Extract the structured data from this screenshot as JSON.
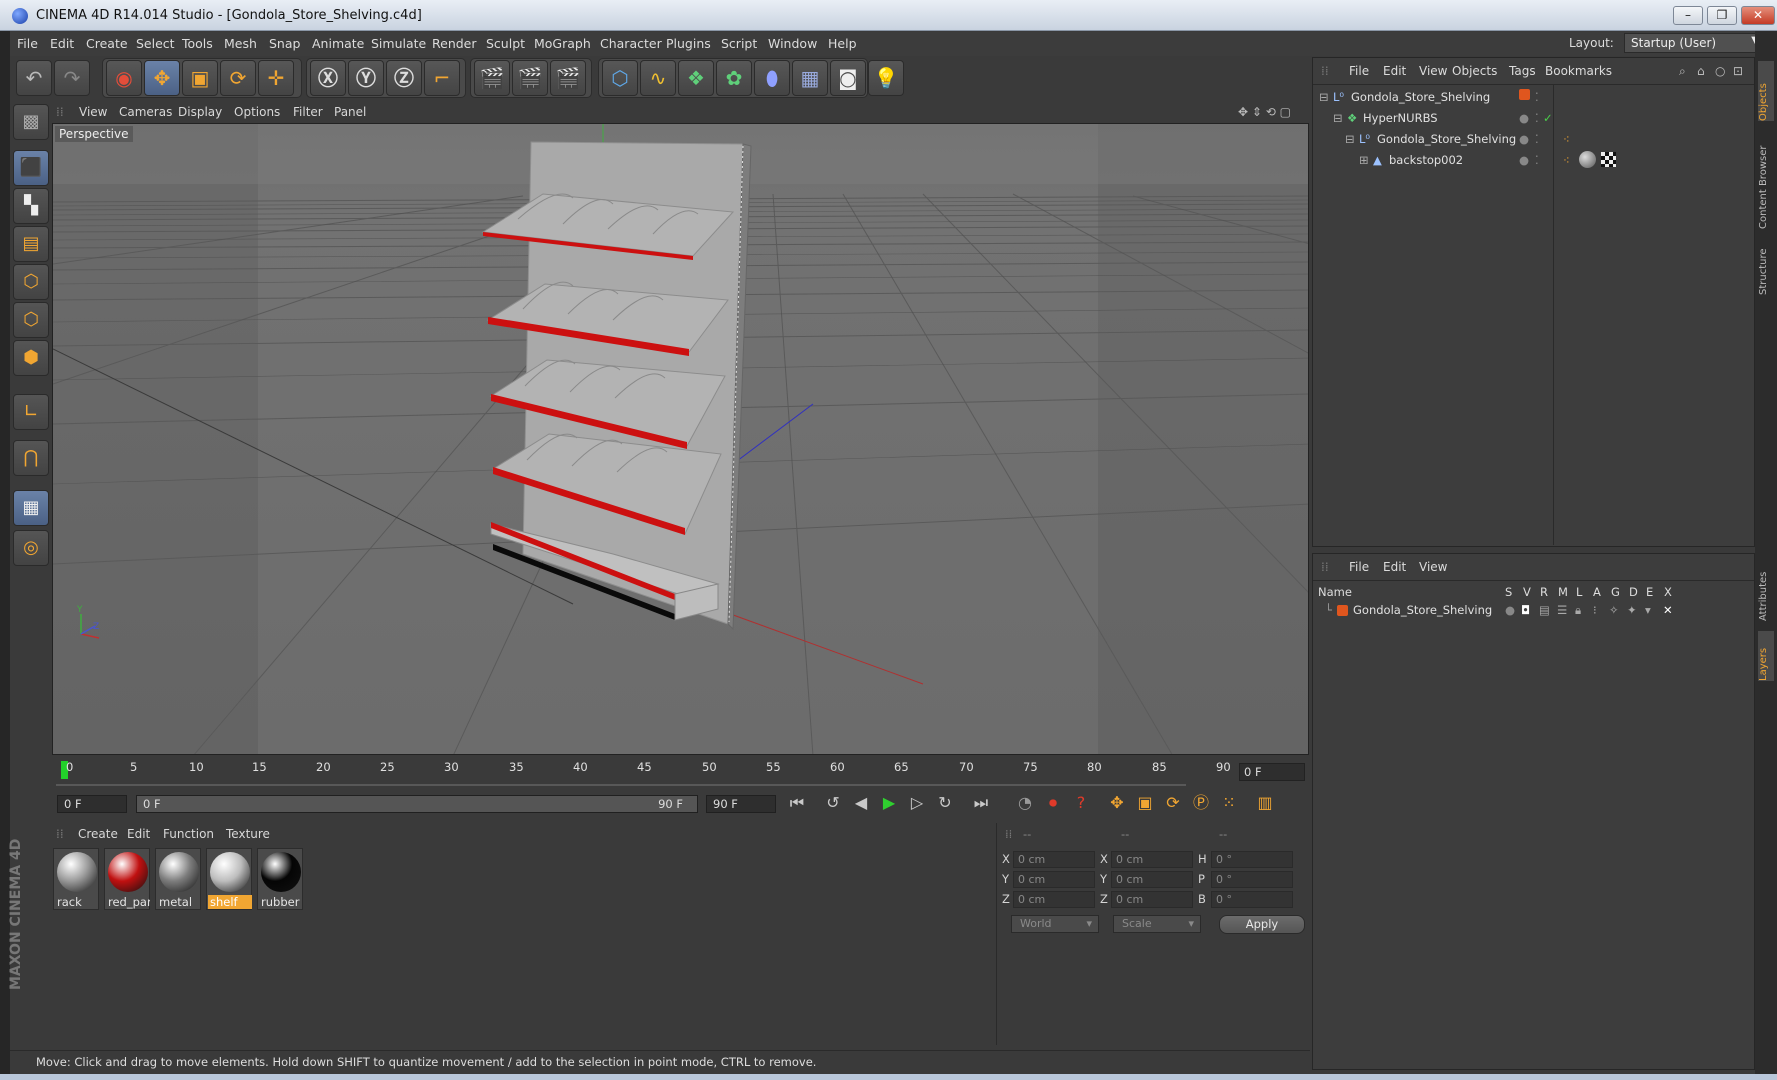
{
  "window": {
    "title": "CINEMA 4D R14.014 Studio - [Gondola_Store_Shelving.c4d]",
    "minimize": "–",
    "maximize": "❐",
    "close": "✕"
  },
  "menubar": {
    "items": [
      "File",
      "Edit",
      "Create",
      "Select",
      "Tools",
      "Mesh",
      "Snap",
      "Animate",
      "Simulate",
      "Render",
      "Sculpt",
      "MoGraph",
      "Character",
      "Plugins",
      "Script",
      "Window",
      "Help"
    ],
    "layout_label": "Layout:",
    "layout_value": "Startup (User)"
  },
  "viewport": {
    "menu": [
      "View",
      "Cameras",
      "Display",
      "Options",
      "Filter",
      "Panel"
    ],
    "label": "Perspective"
  },
  "timeline": {
    "ticks": [
      "0",
      "5",
      "10",
      "15",
      "20",
      "25",
      "30",
      "35",
      "40",
      "45",
      "50",
      "55",
      "60",
      "65",
      "70",
      "75",
      "80",
      "85",
      "90"
    ],
    "current_frame": "0 F",
    "start_field": "0 F",
    "range_start": "0 F",
    "range_end": "90 F",
    "end_field": "90 F"
  },
  "materials": {
    "menu": [
      "Create",
      "Edit",
      "Function",
      "Texture"
    ],
    "items": [
      {
        "name": "rack",
        "color": "#9a9a9a"
      },
      {
        "name": "red_part",
        "color": "#c01010"
      },
      {
        "name": "metal",
        "color": "#7d7d7d"
      },
      {
        "name": "shelf",
        "color": "#bdbdbd"
      },
      {
        "name": "rubber",
        "color": "#050505"
      }
    ],
    "selected": "shelf"
  },
  "coordinates": {
    "headers": [
      "--",
      "--",
      "--"
    ],
    "rows": [
      {
        "a": "X",
        "av": "0 cm",
        "b": "X",
        "bv": "0 cm",
        "c": "H",
        "cv": "0 °"
      },
      {
        "a": "Y",
        "av": "0 cm",
        "b": "Y",
        "bv": "0 cm",
        "c": "P",
        "cv": "0 °"
      },
      {
        "a": "Z",
        "av": "0 cm",
        "b": "Z",
        "bv": "0 cm",
        "c": "B",
        "cv": "0 °"
      }
    ],
    "mode": "World",
    "scale": "Scale",
    "apply": "Apply"
  },
  "object_manager": {
    "menu": [
      "File",
      "Edit",
      "View",
      "Objects",
      "Tags",
      "Bookmarks"
    ],
    "rows": [
      "Gondola_Store_Shelving",
      "HyperNURBS",
      "Gondola_Store_Shelving",
      "backstop002"
    ]
  },
  "layer_manager": {
    "menu": [
      "File",
      "Edit",
      "View"
    ],
    "columns": [
      "Name",
      "S",
      "V",
      "R",
      "M",
      "L",
      "A",
      "G",
      "D",
      "E",
      "X"
    ],
    "rows": [
      "Gondola_Store_Shelving"
    ]
  },
  "right_tabs": [
    "Objects",
    "Content Browser",
    "Structure",
    "Attributes",
    "Layers"
  ],
  "brand": "MAXON CINEMA 4D",
  "status": "Move: Click and drag to move elements. Hold down SHIFT to quantize movement / add to the selection in point mode, CTRL to remove."
}
